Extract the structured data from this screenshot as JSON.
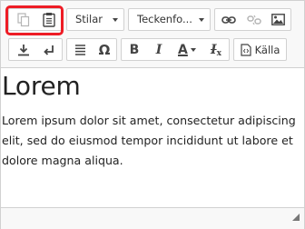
{
  "toolbar": {
    "row1": {
      "copy_icon": "copy-icon",
      "paste_icon": "paste-icon",
      "styles_label": "Stilar",
      "font_label": "Teckenfo...",
      "link_icon": "link-icon",
      "unlink_icon": "unlink-icon",
      "image_icon": "image-icon"
    },
    "row2": {
      "insert_icon": "insert-icon",
      "newline_icon": "newline-icon",
      "align_icon": "align-justify-icon",
      "omega_label": "Ω",
      "bold_label": "B",
      "italic_label": "I",
      "font_color_label": "A",
      "clear_format_label": "I",
      "source_label": "Källa"
    }
  },
  "content": {
    "heading": "Lorem",
    "paragraph": "Lorem ipsum dolor sit amet, consectetur adipiscing elit, sed do eiusmod tempor incididunt ut labore et dolore magna aliqua."
  },
  "colors": {
    "highlight": "#ee1c25",
    "toolbar_bg": "#f8f8f8",
    "border": "#d1d1d1"
  }
}
